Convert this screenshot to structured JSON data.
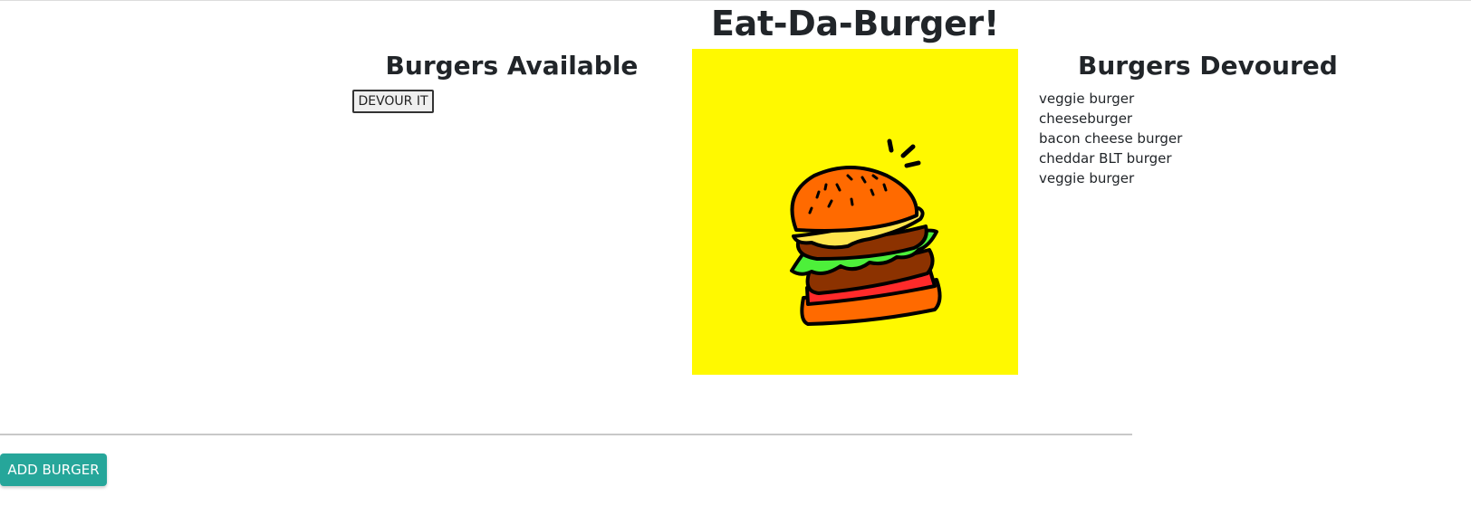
{
  "header": {
    "title": "Eat-Da-Burger!"
  },
  "available": {
    "heading": "Burgers Available",
    "devour_button_label": "DEVOUR IT"
  },
  "devoured": {
    "heading": "Burgers Devoured",
    "items": [
      "veggie burger",
      "cheeseburger",
      "bacon cheese burger",
      "cheddar BLT burger",
      "veggie burger"
    ]
  },
  "footer": {
    "add_button_label": "ADD BURGER"
  },
  "colors": {
    "image_background": "#fff900",
    "add_button": "#26a69a"
  },
  "icons": {
    "hero_image": "burger-illustration"
  }
}
